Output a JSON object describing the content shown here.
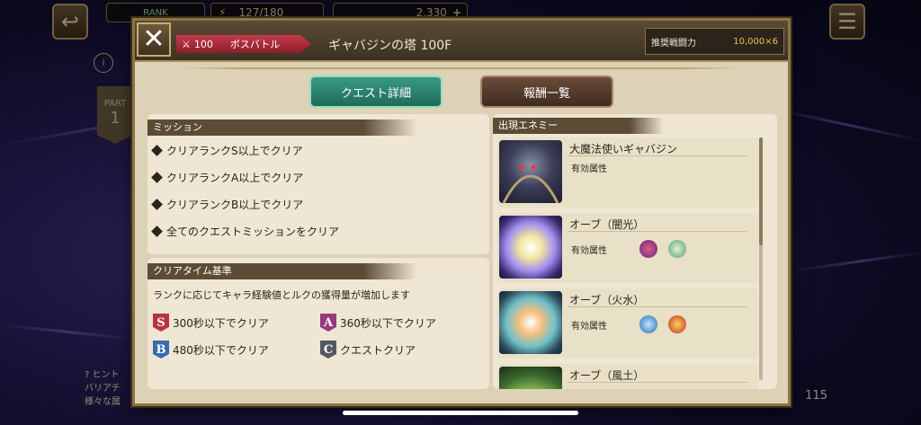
{
  "hud": {
    "rank_label": "RANK",
    "stamina": "127/180",
    "currency": "2,330",
    "hint_label": "ヒント",
    "hint_line1": "バリアチ",
    "hint_line2": "様々な属",
    "party_label": "PART",
    "party_num": "1",
    "bottom_count": "115"
  },
  "header": {
    "level": "100",
    "battle_type": "ボスバトル",
    "title": "ギャバジンの塔 100F",
    "power_label": "推奨戦闘力",
    "power_value": "10,000×6"
  },
  "tabs": {
    "details": "クエスト詳細",
    "rewards": "報酬一覧"
  },
  "mission": {
    "title": "ミッション",
    "items": [
      "クリアランクS以上でクリア",
      "クリアランクA以上でクリア",
      "クリアランクB以上でクリア",
      "全てのクエストミッションをクリア"
    ]
  },
  "cleartime": {
    "title": "クリアタイム基準",
    "desc": "ランクに応じてキャラ経験値とルクの獲得量が増加します",
    "ranks": [
      {
        "letter": "S",
        "text": "300秒以下でクリア",
        "color": "#b8343c"
      },
      {
        "letter": "A",
        "text": "360秒以下でクリア",
        "color": "#9a3a7c"
      },
      {
        "letter": "B",
        "text": "480秒以下でクリア",
        "color": "#3a6bb0"
      },
      {
        "letter": "C",
        "text": "クエストクリア",
        "color": "#55585e"
      }
    ]
  },
  "enemies": {
    "title": "出現エネミー",
    "attr_label": "有効属性",
    "list": [
      {
        "name": "大魔法使いギャバジン",
        "icon": "boss-portrait"
      },
      {
        "name": "オーブ（闇光）",
        "icon": "orb-dark-light"
      },
      {
        "name": "オーブ（火水）",
        "icon": "orb-fire-water"
      },
      {
        "name": "オーブ（風土）",
        "icon": "orb-wind-earth"
      }
    ]
  }
}
